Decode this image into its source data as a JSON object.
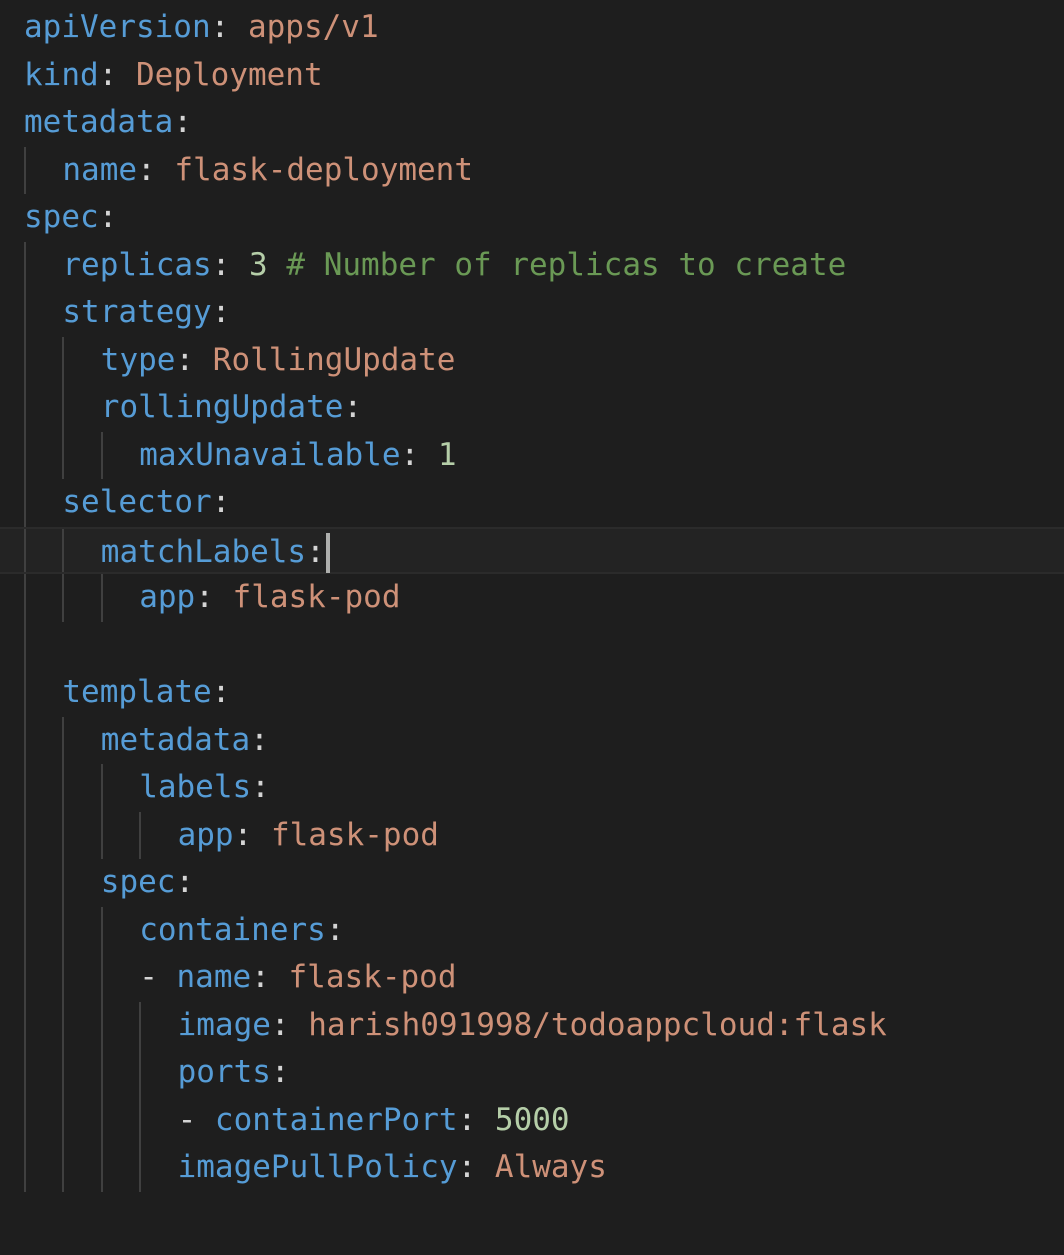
{
  "editor": {
    "colors": {
      "background": "#1e1e1e",
      "key": "#569cd6",
      "string": "#ce9178",
      "number": "#b5cea8",
      "comment": "#6a9955",
      "punctuation": "#d4d4d4",
      "indent_guide": "#404040",
      "cursor": "#aeafad"
    },
    "cursor_line": 11,
    "lines": [
      {
        "indent": 0,
        "dash": false,
        "key": "apiVersion",
        "colon": ":",
        "value": "apps/v1",
        "value_type": "string",
        "comment": ""
      },
      {
        "indent": 0,
        "dash": false,
        "key": "kind",
        "colon": ":",
        "value": "Deployment",
        "value_type": "string",
        "comment": ""
      },
      {
        "indent": 0,
        "dash": false,
        "key": "metadata",
        "colon": ":",
        "value": "",
        "value_type": "",
        "comment": ""
      },
      {
        "indent": 1,
        "dash": false,
        "key": "name",
        "colon": ":",
        "value": "flask-deployment",
        "value_type": "string",
        "comment": ""
      },
      {
        "indent": 0,
        "dash": false,
        "key": "spec",
        "colon": ":",
        "value": "",
        "value_type": "",
        "comment": ""
      },
      {
        "indent": 1,
        "dash": false,
        "key": "replicas",
        "colon": ":",
        "value": "3",
        "value_type": "number",
        "comment": "# Number of replicas to create"
      },
      {
        "indent": 1,
        "dash": false,
        "key": "strategy",
        "colon": ":",
        "value": "",
        "value_type": "",
        "comment": ""
      },
      {
        "indent": 2,
        "dash": false,
        "key": "type",
        "colon": ":",
        "value": "RollingUpdate",
        "value_type": "string",
        "comment": ""
      },
      {
        "indent": 2,
        "dash": false,
        "key": "rollingUpdate",
        "colon": ":",
        "value": "",
        "value_type": "",
        "comment": ""
      },
      {
        "indent": 3,
        "dash": false,
        "key": "maxUnavailable",
        "colon": ":",
        "value": "1",
        "value_type": "number",
        "comment": ""
      },
      {
        "indent": 1,
        "dash": false,
        "key": "selector",
        "colon": ":",
        "value": "",
        "value_type": "",
        "comment": ""
      },
      {
        "indent": 2,
        "dash": false,
        "key": "matchLabels",
        "colon": ":",
        "value": "",
        "value_type": "",
        "comment": ""
      },
      {
        "indent": 3,
        "dash": false,
        "key": "app",
        "colon": ":",
        "value": "flask-pod",
        "value_type": "string",
        "comment": ""
      },
      {
        "indent": 0,
        "dash": false,
        "key": "",
        "colon": "",
        "value": "",
        "value_type": "",
        "comment": ""
      },
      {
        "indent": 1,
        "dash": false,
        "key": "template",
        "colon": ":",
        "value": "",
        "value_type": "",
        "comment": ""
      },
      {
        "indent": 2,
        "dash": false,
        "key": "metadata",
        "colon": ":",
        "value": "",
        "value_type": "",
        "comment": ""
      },
      {
        "indent": 3,
        "dash": false,
        "key": "labels",
        "colon": ":",
        "value": "",
        "value_type": "",
        "comment": ""
      },
      {
        "indent": 4,
        "dash": false,
        "key": "app",
        "colon": ":",
        "value": "flask-pod",
        "value_type": "string",
        "comment": ""
      },
      {
        "indent": 2,
        "dash": false,
        "key": "spec",
        "colon": ":",
        "value": "",
        "value_type": "",
        "comment": ""
      },
      {
        "indent": 3,
        "dash": false,
        "key": "containers",
        "colon": ":",
        "value": "",
        "value_type": "",
        "comment": ""
      },
      {
        "indent": 3,
        "dash": true,
        "key": "name",
        "colon": ":",
        "value": "flask-pod",
        "value_type": "string",
        "comment": ""
      },
      {
        "indent": 4,
        "dash": false,
        "key": "image",
        "colon": ":",
        "value": "harish091998/todoappcloud:flask",
        "value_type": "string",
        "comment": ""
      },
      {
        "indent": 4,
        "dash": false,
        "key": "ports",
        "colon": ":",
        "value": "",
        "value_type": "",
        "comment": ""
      },
      {
        "indent": 4,
        "dash": true,
        "key": "containerPort",
        "colon": ":",
        "value": "5000",
        "value_type": "number",
        "comment": ""
      },
      {
        "indent": 4,
        "dash": false,
        "key": "imagePullPolicy",
        "colon": ":",
        "value": "Always",
        "value_type": "string",
        "comment": ""
      }
    ],
    "indent_guides": [
      {
        "line": 3,
        "levels": 1
      },
      {
        "line": 5,
        "levels": 1
      },
      {
        "line": 6,
        "levels": 1
      },
      {
        "line": 7,
        "levels": 2
      },
      {
        "line": 8,
        "levels": 2
      },
      {
        "line": 9,
        "levels": 3
      },
      {
        "line": 10,
        "levels": 1
      },
      {
        "line": 11,
        "levels": 2
      },
      {
        "line": 12,
        "levels": 3
      },
      {
        "line": 13,
        "levels": 1
      },
      {
        "line": 14,
        "levels": 1
      },
      {
        "line": 15,
        "levels": 2
      },
      {
        "line": 16,
        "levels": 3
      },
      {
        "line": 17,
        "levels": 4
      },
      {
        "line": 18,
        "levels": 2
      },
      {
        "line": 19,
        "levels": 3
      },
      {
        "line": 20,
        "levels": 3
      },
      {
        "line": 21,
        "levels": 4
      },
      {
        "line": 22,
        "levels": 4
      },
      {
        "line": 23,
        "levels": 4
      },
      {
        "line": 24,
        "levels": 4
      }
    ]
  }
}
